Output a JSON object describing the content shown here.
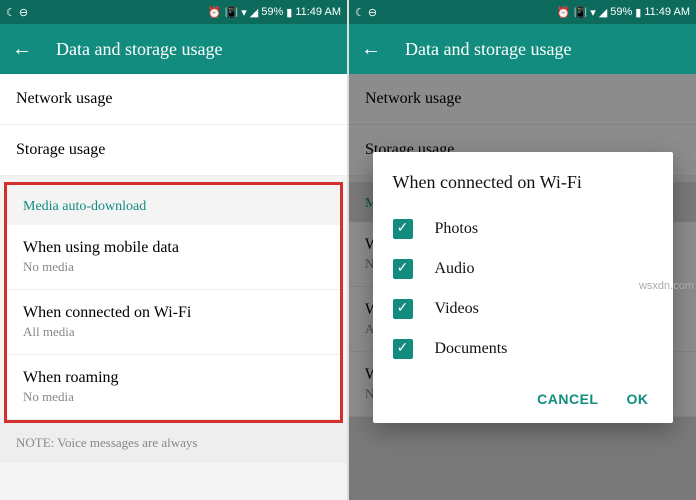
{
  "status": {
    "battery_pct": "59%",
    "time": "11:49 AM"
  },
  "header": {
    "title": "Data and storage usage"
  },
  "list": {
    "network": "Network usage",
    "storage": "Storage usage"
  },
  "media": {
    "header": "Media auto-download",
    "mobile": {
      "title": "When using mobile data",
      "sub": "No media"
    },
    "wifi": {
      "title": "When connected on Wi-Fi",
      "sub": "All media"
    },
    "roaming": {
      "title": "When roaming",
      "sub": "No media"
    }
  },
  "note": "NOTE: Voice messages are always",
  "dialog": {
    "title": "When connected on Wi-Fi",
    "opts": {
      "photos": "Photos",
      "audio": "Audio",
      "videos": "Videos",
      "documents": "Documents"
    },
    "cancel": "CANCEL",
    "ok": "OK"
  },
  "watermark": "wsxdn.com"
}
